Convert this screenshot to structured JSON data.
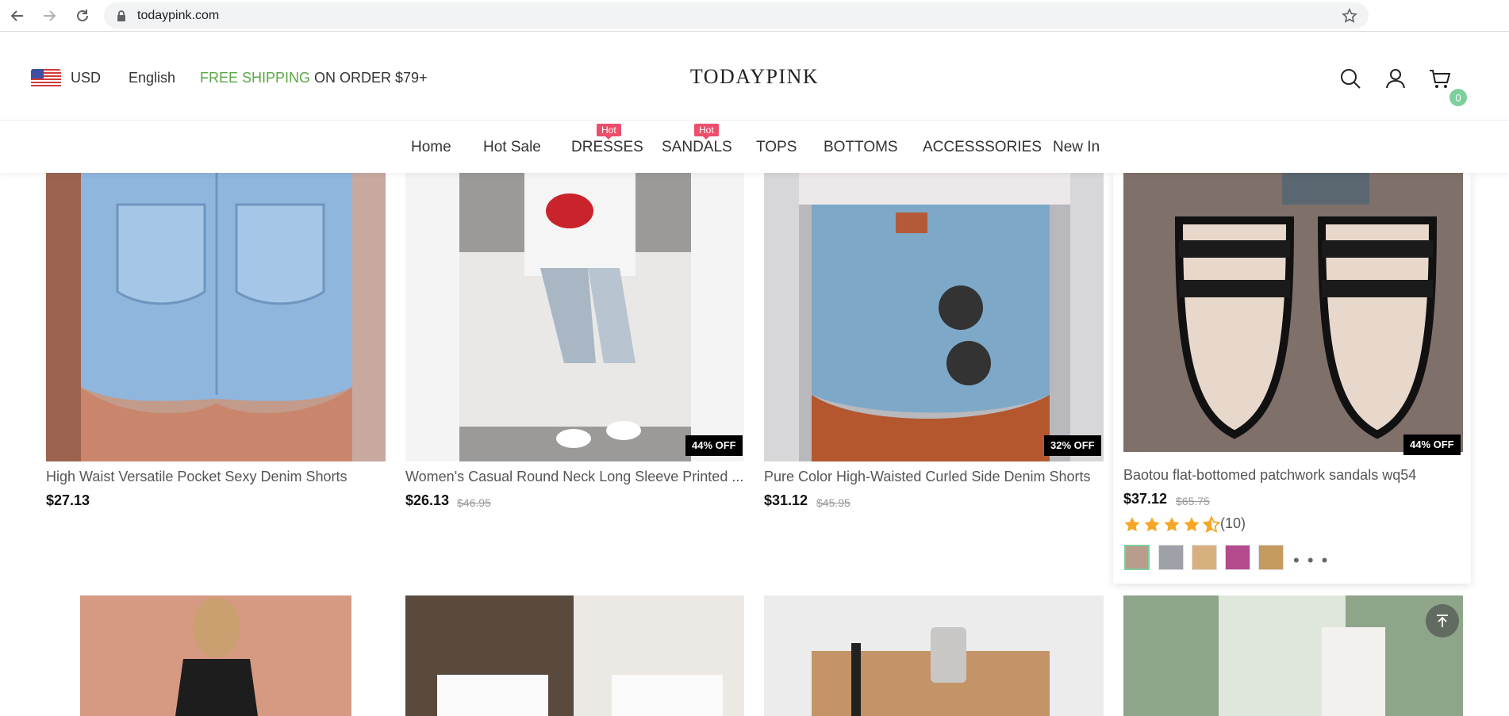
{
  "browser": {
    "url": "todaypink.com"
  },
  "header": {
    "currency": "USD",
    "language": "English",
    "shipping_highlight": "FREE SHIPPING",
    "shipping_rest": " ON ORDER $79+",
    "logo": "TODAYPINK",
    "cart_count": "0"
  },
  "nav": {
    "items": [
      {
        "label": "Home"
      },
      {
        "label": "Hot Sale"
      },
      {
        "label": "DRESSES",
        "tag": "Hot"
      },
      {
        "label": "SANDALS",
        "tag": "Hot"
      },
      {
        "label": "TOPS"
      },
      {
        "label": "BOTTOMS"
      },
      {
        "label": "ACCESSSORIES"
      },
      {
        "label": "New In"
      }
    ]
  },
  "products": [
    {
      "title": "High Waist Versatile Pocket Sexy Denim Shorts",
      "price": "$27.13",
      "old_price": "",
      "discount": ""
    },
    {
      "title": "Women's Casual Round Neck Long Sleeve Printed ...",
      "price": "$26.13",
      "old_price": "$46.95",
      "discount": "44% OFF"
    },
    {
      "title": "Pure Color High-Waisted Curled Side Denim Shorts",
      "price": "$31.12",
      "old_price": "$45.95",
      "discount": "32% OFF"
    },
    {
      "title": "Baotou flat-bottomed patchwork sandals wq54",
      "price": "$37.12",
      "old_price": "$65.75",
      "discount": "44% OFF",
      "rating": 4.5,
      "reviews": "(10)",
      "more": "• • •"
    }
  ],
  "colors": {
    "accent_green": "#5aa845",
    "hot_tag": "#ec4e6b",
    "cart_badge": "#7dcf9c"
  }
}
